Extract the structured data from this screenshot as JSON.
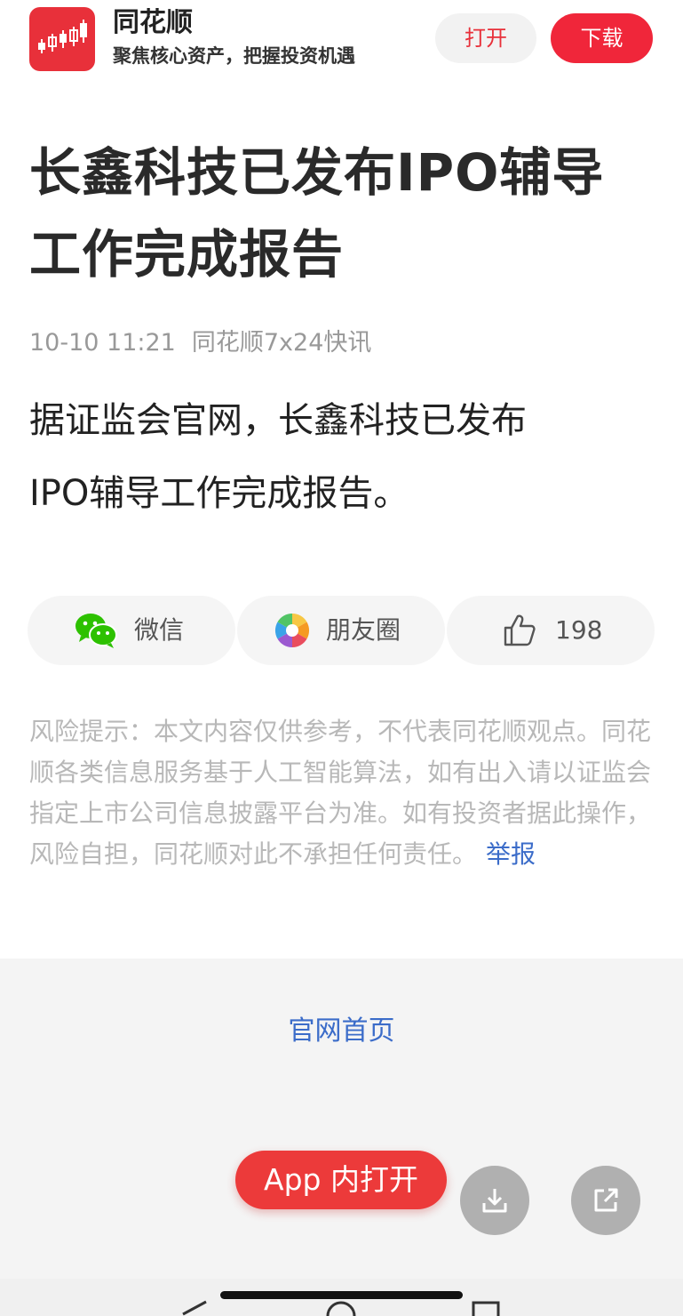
{
  "header": {
    "app_name": "同花顺",
    "slogan": "聚焦核心资产，把握投资机遇",
    "open_label": "打开",
    "download_label": "下载"
  },
  "article": {
    "title_line1": "长鑫科技已发布IPO辅导",
    "title_line2": "工作完成报告",
    "date": "10-10 11:21",
    "source": "同花顺7x24快讯",
    "body_line1": "据证监会官网，长鑫科技已发布",
    "body_line2": "IPO辅导工作完成报告。"
  },
  "share": {
    "wechat_label": "微信",
    "moments_label": "朋友圈",
    "like_count": "198"
  },
  "risk": {
    "text": "风险提示：本文内容仅供参考，不代表同花顺观点。同花顺各类信息服务基于人工智能算法，如有出入请以证监会指定上市公司信息披露平台为准。如有投资者据此操作，风险自担，同花顺对此不承担任何责任。",
    "report_label": "举报"
  },
  "footer": {
    "homepage_label": "官网首页",
    "app_open_label": "App 内打开"
  },
  "icons": {
    "logo": "stock-candlestick-logo",
    "wechat": "wechat-icon",
    "moments": "moments-icon",
    "like": "thumbs-up-icon",
    "download": "download-icon",
    "share": "share-icon"
  },
  "colors": {
    "brand_red": "#e8303a",
    "download_red": "#f0263a",
    "link_blue": "#3b6cc9",
    "wechat_green": "#2dc100"
  }
}
